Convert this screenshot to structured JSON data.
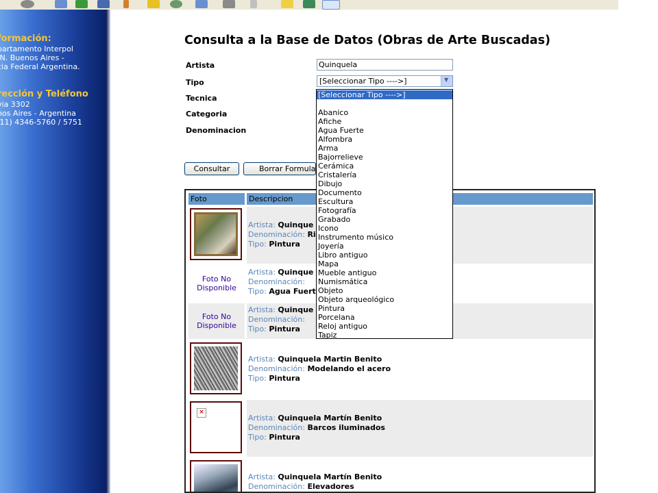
{
  "sidebar": {
    "info_heading": "formación:",
    "info_lines": [
      "partamento Interpol",
      ".N. Buenos Aires -",
      "cia Federal Argentina."
    ],
    "contact_heading": "rección y Teléfono",
    "contact_lines": [
      "via 3302",
      "nos Aires - Argentina",
      ".11) 4346-5760 / 5751"
    ]
  },
  "page": {
    "title": "Consulta a la Base de Datos (Obras de Arte Buscadas)"
  },
  "form": {
    "artista_label": "Artista",
    "artista_value": "Quinquela",
    "tipo_label": "Tipo",
    "tipo_selected": "[Seleccionar Tipo ---->]",
    "tecnica_label": "Tecnica",
    "categoria_label": "Categoria",
    "denominacion_label": "Denominacion",
    "consultar_label": "Consultar",
    "borrar_label": "Borrar Formulario"
  },
  "tipo_options": [
    "[Seleccionar Tipo ---->]",
    "",
    "Abanico",
    "Afiche",
    "Agua Fuerte",
    "Alfombra",
    "Arma",
    "Bajorrelieve",
    "Cerámica",
    "Cristalería",
    "Dibujo",
    "Documento",
    "Escultura",
    "Fotografía",
    "Grabado",
    "Icono",
    "Instrumento músico",
    "Joyería",
    "Libro antiguo",
    "Mapa",
    "Mueble antiguo",
    "Numismática",
    "Objeto",
    "Objeto arqueológico",
    "Pintura",
    "Porcelana",
    "Reloj antiguo",
    "Tapiz"
  ],
  "results": {
    "col_foto": "Foto",
    "col_descripcion": "Descripcion",
    "label_artista": "Artista:",
    "label_denominacion": "Denominación:",
    "label_tipo": "Tipo:",
    "no_photo_line1": "Foto No",
    "no_photo_line2": "Disponible",
    "rows": [
      {
        "photo": "painting",
        "artista": "Quinque",
        "denominacion": "Ri",
        "tipo": "Pintura"
      },
      {
        "photo": "none",
        "artista": "Quinque",
        "denominacion": "",
        "tipo": "Agua Fuerte"
      },
      {
        "photo": "none",
        "artista": "Quinque",
        "denominacion": "",
        "tipo": "Pintura"
      },
      {
        "photo": "bw-painting",
        "artista": "Quinquela Martin Benito",
        "denominacion": "Modelando el acero",
        "tipo": "Pintura"
      },
      {
        "photo": "broken",
        "artista": "Quinquela Martín Benito",
        "denominacion": "Barcos iluminados",
        "tipo": "Pintura"
      },
      {
        "photo": "painting2",
        "artista": "Quinquela Martín Benito",
        "denominacion": "Elevadores",
        "tipo": ""
      }
    ]
  },
  "colors": {
    "header_bg": "#6699cc",
    "label_blue": "#5a86b8",
    "sidebar_heading": "#f3c638"
  }
}
